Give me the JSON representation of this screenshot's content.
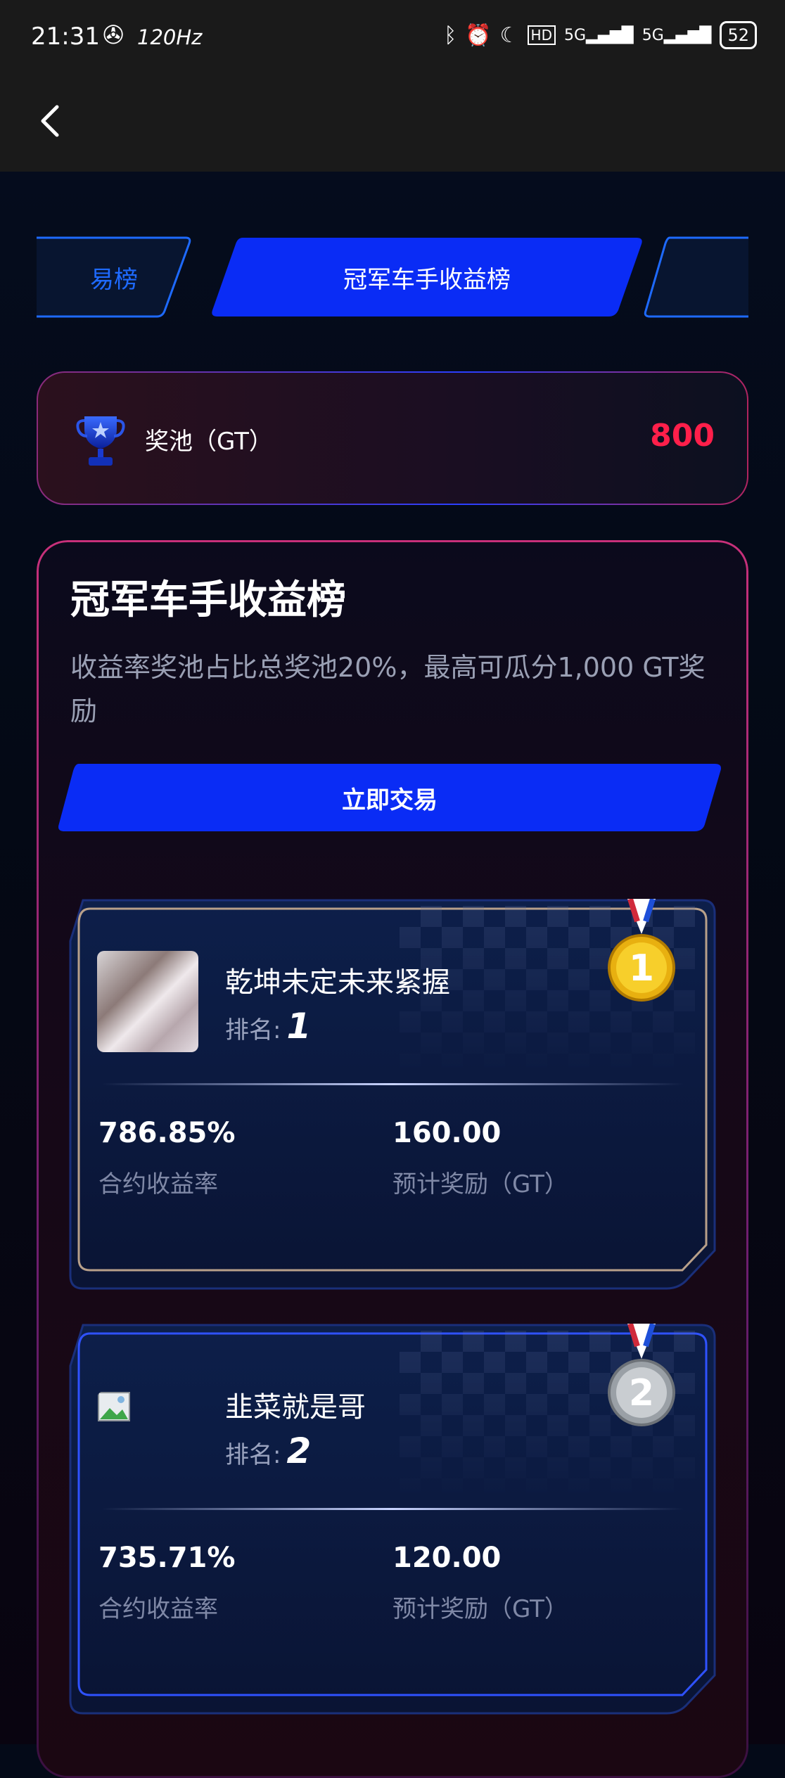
{
  "status_bar": {
    "time": "21:31",
    "refresh": "120Hz",
    "battery": "52",
    "icons": [
      "fan-icon",
      "bluetooth-icon",
      "alarm-icon",
      "moon-icon",
      "hd-icon",
      "signal-5g-icon",
      "signal-5g-icon"
    ]
  },
  "header": {
    "back_icon": "chevron-left-icon"
  },
  "tabs": [
    {
      "label": "易榜",
      "state": "partial-left"
    },
    {
      "label": "冠军车手收益榜",
      "state": "active"
    },
    {
      "label": "",
      "state": "partial-right"
    }
  ],
  "pool": {
    "label": "奖池（GT）",
    "value": "800",
    "value_color": "#ff1f4a",
    "icon": "trophy-icon"
  },
  "leaderboard": {
    "title": "冠军车手收益榜",
    "description": "收益率奖池占比总奖池20%，最高可瓜分1,000 GT奖励",
    "trade_button": "立即交易",
    "rank_prefix": "排名:",
    "entries": [
      {
        "name": "乾坤未定未来紧握",
        "rank": "1",
        "avatar": "photo",
        "medal": "gold-medal-icon",
        "return_value": "786.85%",
        "return_label": "合约收益率",
        "reward_value": "160.00",
        "reward_label": "预计奖励（GT）"
      },
      {
        "name": "韭菜就是哥",
        "rank": "2",
        "avatar": "broken-image",
        "medal": "silver-medal-icon",
        "return_value": "735.71%",
        "return_label": "合约收益率",
        "reward_value": "120.00",
        "reward_label": "预计奖励（GT）"
      }
    ]
  },
  "colors": {
    "accent": "#0a3cff",
    "background": "#040a18"
  }
}
